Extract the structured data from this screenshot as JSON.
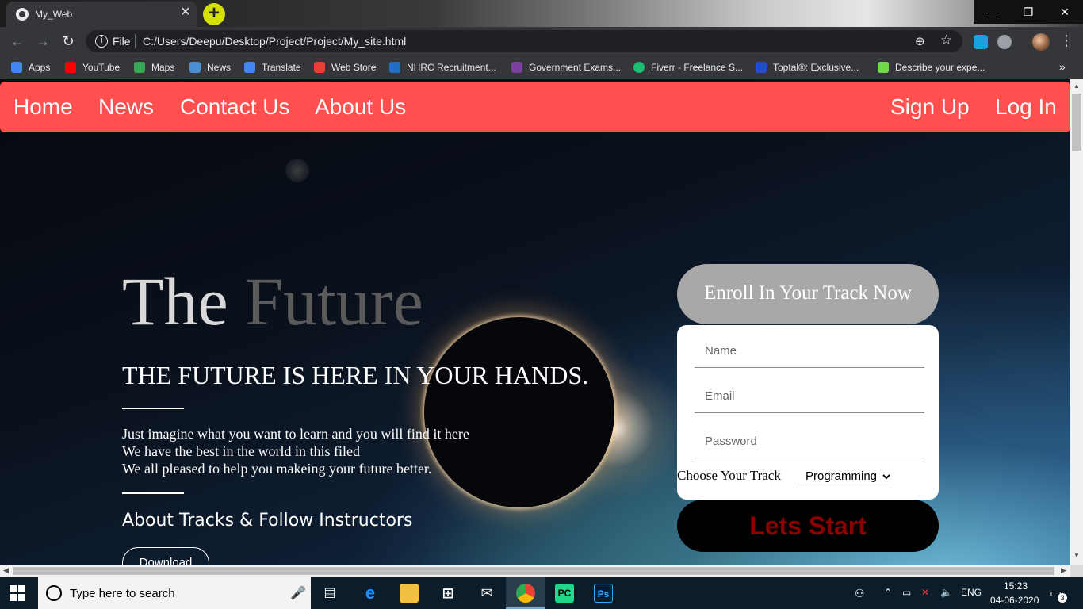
{
  "browser": {
    "tab_title": "My_Web",
    "tab_close": "✕",
    "new_tab": "+",
    "window_min": "—",
    "window_max": "❐",
    "window_close": "✕",
    "omnibox_scheme": "File",
    "omnibox_url": "C:/Users/Deepu/Desktop/Project/Project/My_site.html",
    "bookmarks": [
      {
        "label": "Apps",
        "icon": "apps-grid-icon",
        "color": "#4285f4"
      },
      {
        "label": "YouTube",
        "icon": "youtube-icon",
        "color": "#ff0000"
      },
      {
        "label": "Maps",
        "icon": "maps-icon",
        "color": "#34a853"
      },
      {
        "label": "News",
        "icon": "news-icon",
        "color": "#4a90d9"
      },
      {
        "label": "Translate",
        "icon": "translate-icon",
        "color": "#4285f4"
      },
      {
        "label": "Web Store",
        "icon": "web-store-icon",
        "color": "#e94235"
      },
      {
        "label": "NHRC Recruitment...",
        "icon": "nhrc-icon",
        "color": "#1f6fc5"
      },
      {
        "label": "Government Exams...",
        "icon": "gov-exams-icon",
        "color": "#7b3fa0"
      },
      {
        "label": "Fiverr - Freelance S...",
        "icon": "fiverr-icon",
        "color": "#1dbf73"
      },
      {
        "label": "Toptal®: Exclusive...",
        "icon": "toptal-icon",
        "color": "#204ecf"
      },
      {
        "label": "Describe your expe...",
        "icon": "upwork-icon",
        "color": "#6fda44"
      }
    ],
    "bookmarks_more": "»"
  },
  "site": {
    "nav_left": [
      "Home",
      "News",
      "Contact Us",
      "About Us"
    ],
    "nav_right": [
      "Sign Up",
      "Log In"
    ],
    "nav_color": "#ff4f4f",
    "hero_the": "The",
    "hero_future": "Future",
    "hero_subtitle": "THE FUTURE IS HERE IN YOUR HANDS.",
    "hero_lines": [
      "Just imagine what you want to learn and you will find it here",
      "We have the best in the world in this filed",
      "We all pleased to help you makeing your future better."
    ],
    "hero_tracks": "About Tracks & Follow Instructors",
    "download_label": "Download",
    "enroll": {
      "heading": "Enroll In Your Track Now",
      "name_placeholder": "Name",
      "email_placeholder": "Email",
      "password_placeholder": "Password",
      "track_label": "Choose Your Track",
      "track_selected": "Programming",
      "submit_label": "Lets Start"
    }
  },
  "taskbar": {
    "search_placeholder": "Type here to search",
    "tray_language": "ENG",
    "clock_time": "15:23",
    "clock_date": "04-06-2020",
    "notification_count": "3"
  }
}
